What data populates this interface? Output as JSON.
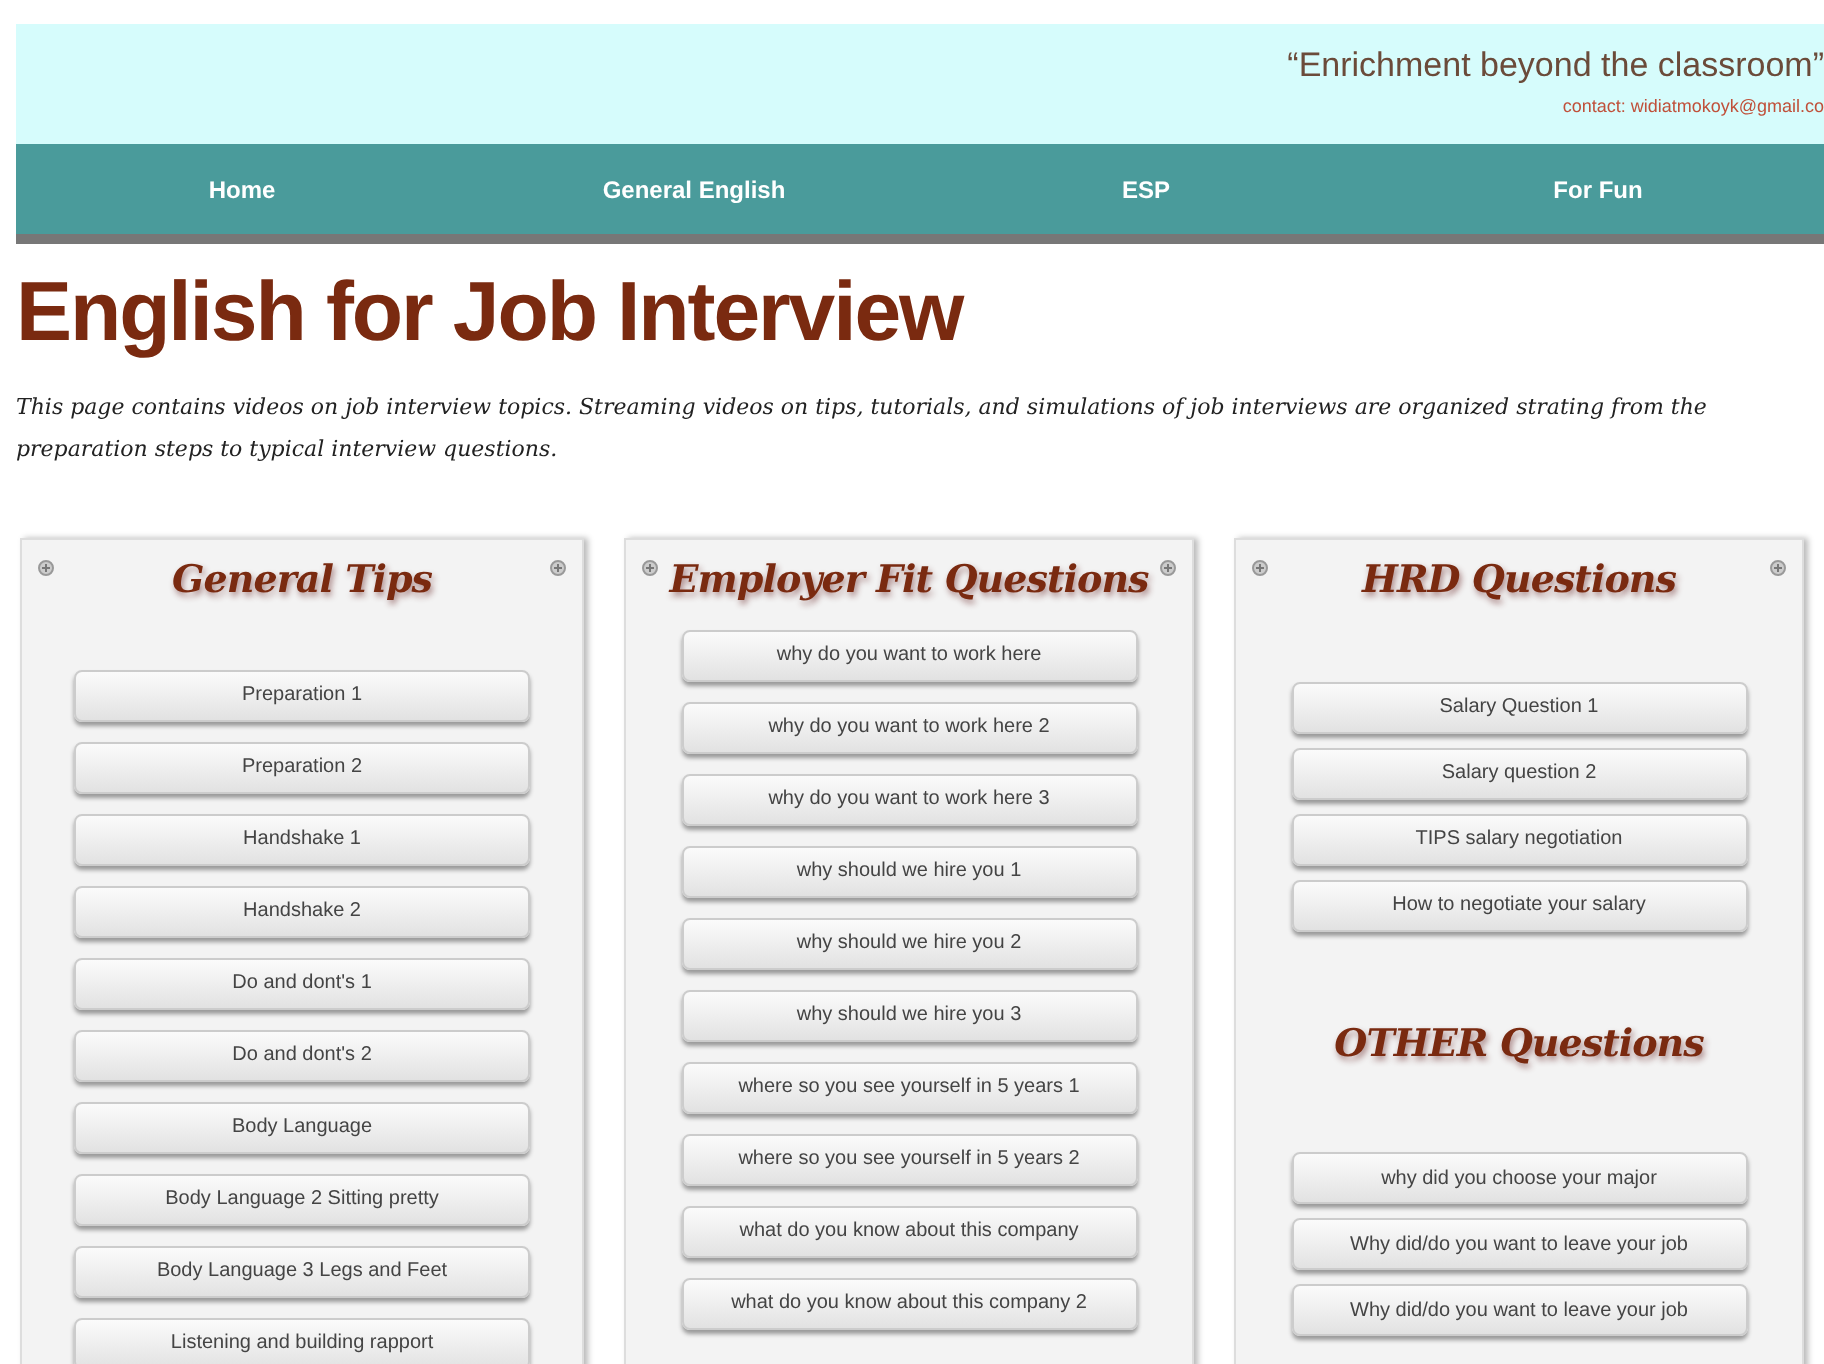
{
  "header": {
    "tagline": "“Enrichment beyond the classroom”",
    "contact": "contact: widiatmokoyk@gmail.co"
  },
  "nav": [
    {
      "label": "Home"
    },
    {
      "label": "General English"
    },
    {
      "label": "ESP"
    },
    {
      "label": "For Fun"
    }
  ],
  "page_title": "English for Job Interview",
  "description": "This page contains videos on job interview topics. Streaming videos on tips, tutorials, and simulations of job interviews are organized strating from the preparation steps to typical interview questions.",
  "panels": [
    {
      "groups": [
        {
          "title": "General Tips",
          "items": [
            "Preparation 1",
            "Preparation 2",
            "Handshake 1",
            "Handshake 2",
            "Do and dont's 1",
            "Do and dont's 2",
            "Body Language",
            "Body Language 2 Sitting pretty",
            "Body Language 3 Legs and Feet",
            "Listening and building rapport"
          ]
        }
      ]
    },
    {
      "groups": [
        {
          "title": "Employer Fit Questions",
          "items": [
            "why do you want to work here",
            "why do you want to work here 2",
            "why do you want to work here 3",
            "why should we hire you 1",
            "why should we hire you 2",
            "why should we hire you 3",
            "where so you see yourself in 5 years 1",
            "where so you see yourself in 5 years 2",
            "what do you know about this company",
            "what do you know about this company 2"
          ]
        }
      ]
    },
    {
      "groups": [
        {
          "title": "HRD Questions",
          "items": [
            "Salary Question 1",
            "Salary question 2",
            "TIPS salary negotiation",
            "How to negotiate your salary"
          ]
        },
        {
          "title": "OTHER Questions",
          "items": [
            "why did you choose your major",
            "Why did/do you want to leave your job",
            "Why did/do you want to leave your job"
          ]
        }
      ]
    }
  ]
}
